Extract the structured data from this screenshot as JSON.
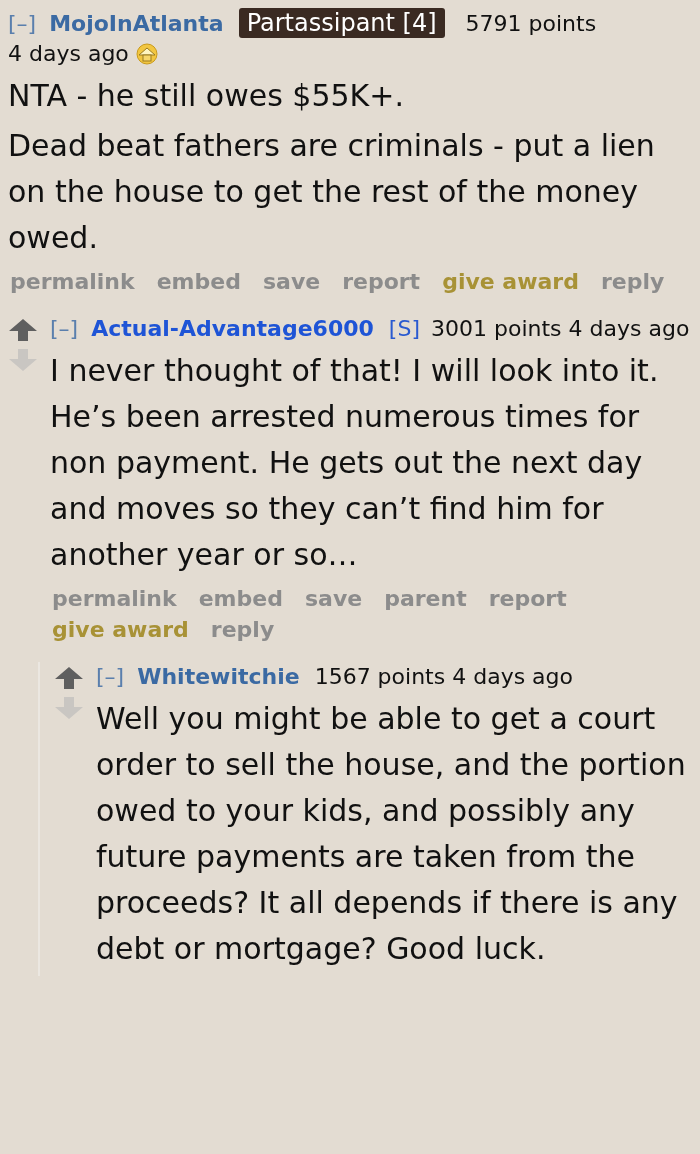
{
  "comments": [
    {
      "collapse": "[–]",
      "author": "MojoInAtlanta",
      "submitter": false,
      "flair": "Partassipant [4]",
      "score": "5791 points",
      "age": "4 days ago",
      "awarded": true,
      "paragraphs": [
        "NTA - he still owes $55K+.",
        "Dead beat fathers are criminals - put a lien on the house to get the rest of the money owed."
      ],
      "actions": [
        {
          "label": "permalink",
          "kind": "link"
        },
        {
          "label": "embed",
          "kind": "link"
        },
        {
          "label": "save",
          "kind": "link"
        },
        {
          "label": "report",
          "kind": "link"
        },
        {
          "label": "give award",
          "kind": "award"
        },
        {
          "label": "reply",
          "kind": "link"
        }
      ],
      "children": [
        {
          "collapse": "[–]",
          "author": "Actual-Advantage6000",
          "submitter": true,
          "tag": "[S]",
          "score": "3001 points",
          "age": "4 days ago",
          "paragraphs": [
            "I never thought of that! I will look into it. He’s been arrested numerous times for non payment. He gets out the next day and moves so they can’t find him for another year or so…"
          ],
          "actions": [
            {
              "label": "permalink",
              "kind": "link"
            },
            {
              "label": "embed",
              "kind": "link"
            },
            {
              "label": "save",
              "kind": "link"
            },
            {
              "label": "parent",
              "kind": "link"
            },
            {
              "label": "report",
              "kind": "link"
            },
            {
              "label": "give award",
              "kind": "award"
            },
            {
              "label": "reply",
              "kind": "link"
            }
          ],
          "children": [
            {
              "collapse": "[–]",
              "author": "Whitewitchie",
              "submitter": false,
              "score": "1567 points",
              "age": "4 days ago",
              "paragraphs": [
                "Well you might be able to get a court order to sell the house, and the portion owed to your kids, and possibly any future payments are taken from the proceeds? It all depends if there is any debt or mortgage? Good luck."
              ]
            }
          ]
        }
      ]
    }
  ]
}
